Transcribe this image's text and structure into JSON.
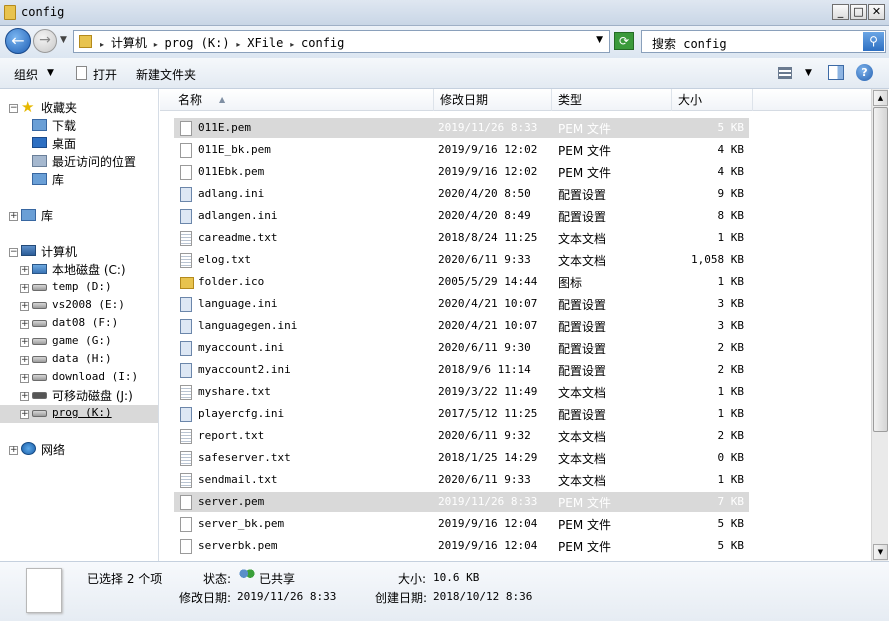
{
  "window": {
    "title": "config"
  },
  "nav": {
    "breadcrumb": [
      "计算机",
      "prog (K:)",
      "XFile",
      "config"
    ],
    "search_placeholder": "搜索 config"
  },
  "toolbar": {
    "organize": "组织",
    "open": "打开",
    "new_folder": "新建文件夹"
  },
  "tree": {
    "favorites": "收藏夹",
    "downloads": "下载",
    "desktop": "桌面",
    "recent": "最近访问的位置",
    "fav_library": "库",
    "libraries": "库",
    "computer": "计算机",
    "drives": [
      {
        "label": "本地磁盘 (C:)"
      },
      {
        "label": "temp (D:)"
      },
      {
        "label": "vs2008 (E:)"
      },
      {
        "label": "dat08 (F:)"
      },
      {
        "label": "game (G:)"
      },
      {
        "label": "data (H:)"
      },
      {
        "label": "download (I:)"
      },
      {
        "label": "可移动磁盘 (J:)"
      },
      {
        "label": "prog (K:)"
      }
    ],
    "network": "网络"
  },
  "columns": {
    "name": "名称",
    "date": "修改日期",
    "type": "类型",
    "size": "大小"
  },
  "files": [
    {
      "name": "011E.pem",
      "date": "2019/11/26 8:33",
      "type": "PEM 文件",
      "size": "5 KB",
      "icon": "generic",
      "selected": true
    },
    {
      "name": "011E_bk.pem",
      "date": "2019/9/16 12:02",
      "type": "PEM 文件",
      "size": "4 KB",
      "icon": "generic",
      "selected": false
    },
    {
      "name": "011Ebk.pem",
      "date": "2019/9/16 12:02",
      "type": "PEM 文件",
      "size": "4 KB",
      "icon": "generic",
      "selected": false
    },
    {
      "name": "adlang.ini",
      "date": "2020/4/20 8:50",
      "type": "配置设置",
      "size": "9 KB",
      "icon": "config",
      "selected": false
    },
    {
      "name": "adlangen.ini",
      "date": "2020/4/20 8:49",
      "type": "配置设置",
      "size": "8 KB",
      "icon": "config",
      "selected": false
    },
    {
      "name": "careadme.txt",
      "date": "2018/8/24 11:25",
      "type": "文本文档",
      "size": "1 KB",
      "icon": "text",
      "selected": false
    },
    {
      "name": "elog.txt",
      "date": "2020/6/11 9:33",
      "type": "文本文档",
      "size": "1,058 KB",
      "icon": "text",
      "selected": false
    },
    {
      "name": "folder.ico",
      "date": "2005/5/29 14:44",
      "type": "图标",
      "size": "1 KB",
      "icon": "icon",
      "selected": false
    },
    {
      "name": "language.ini",
      "date": "2020/4/21 10:07",
      "type": "配置设置",
      "size": "3 KB",
      "icon": "config",
      "selected": false
    },
    {
      "name": "languagegen.ini",
      "date": "2020/4/21 10:07",
      "type": "配置设置",
      "size": "3 KB",
      "icon": "config",
      "selected": false
    },
    {
      "name": "myaccount.ini",
      "date": "2020/6/11 9:30",
      "type": "配置设置",
      "size": "2 KB",
      "icon": "config",
      "selected": false
    },
    {
      "name": "myaccount2.ini",
      "date": "2018/9/6 11:14",
      "type": "配置设置",
      "size": "2 KB",
      "icon": "config",
      "selected": false
    },
    {
      "name": "myshare.txt",
      "date": "2019/3/22 11:49",
      "type": "文本文档",
      "size": "1 KB",
      "icon": "text",
      "selected": false
    },
    {
      "name": "playercfg.ini",
      "date": "2017/5/12 11:25",
      "type": "配置设置",
      "size": "1 KB",
      "icon": "config",
      "selected": false
    },
    {
      "name": "report.txt",
      "date": "2020/6/11 9:32",
      "type": "文本文档",
      "size": "2 KB",
      "icon": "text",
      "selected": false
    },
    {
      "name": "safeserver.txt",
      "date": "2018/1/25 14:29",
      "type": "文本文档",
      "size": "0 KB",
      "icon": "text",
      "selected": false
    },
    {
      "name": "sendmail.txt",
      "date": "2020/6/11 9:33",
      "type": "文本文档",
      "size": "1 KB",
      "icon": "text",
      "selected": false
    },
    {
      "name": "server.pem",
      "date": "2019/11/26 8:33",
      "type": "PEM 文件",
      "size": "7 KB",
      "icon": "generic",
      "selected": true
    },
    {
      "name": "server_bk.pem",
      "date": "2019/9/16 12:04",
      "type": "PEM 文件",
      "size": "5 KB",
      "icon": "generic",
      "selected": false
    },
    {
      "name": "serverbk.pem",
      "date": "2019/9/16 12:04",
      "type": "PEM 文件",
      "size": "5 KB",
      "icon": "generic",
      "selected": false
    }
  ],
  "details": {
    "selected_count": "已选择 2 个项",
    "status_label": "状态:",
    "status": "已共享",
    "size_label": "大小:",
    "size": "10.6 KB",
    "modified_label": "修改日期:",
    "modified": "2019/11/26 8:33",
    "created_label": "创建日期:",
    "created": "2018/10/12 8:36"
  }
}
